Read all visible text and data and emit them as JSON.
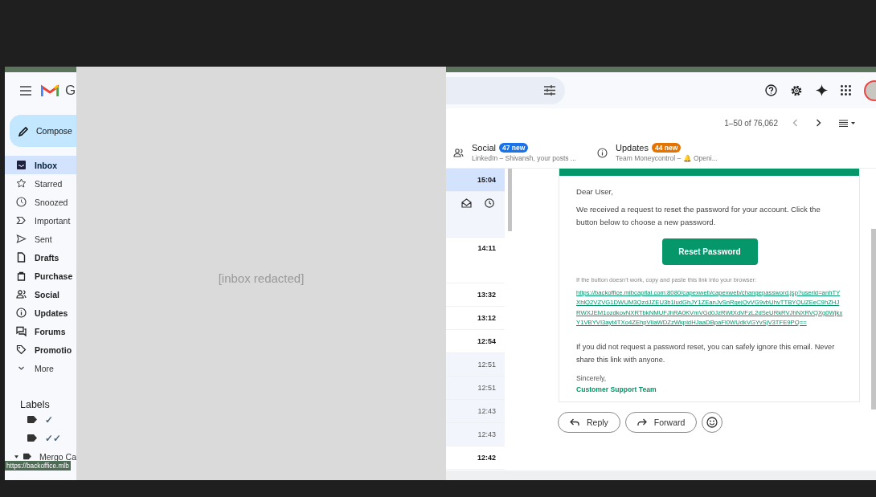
{
  "app_header": {
    "brand_letter": "G"
  },
  "compose": {
    "label": "Compose"
  },
  "sidebar": {
    "items": [
      {
        "label": "Inbox",
        "selected": true,
        "unread": true
      },
      {
        "label": "Starred",
        "selected": false,
        "unread": false
      },
      {
        "label": "Snoozed",
        "selected": false,
        "unread": false
      },
      {
        "label": "Important",
        "selected": false,
        "unread": false
      },
      {
        "label": "Sent",
        "selected": false,
        "unread": false
      },
      {
        "label": "Drafts",
        "selected": false,
        "unread": true
      },
      {
        "label": "Purchase",
        "selected": false,
        "unread": true
      },
      {
        "label": "Social",
        "selected": false,
        "unread": true
      },
      {
        "label": "Updates",
        "selected": false,
        "unread": true
      },
      {
        "label": "Forums",
        "selected": false,
        "unread": true
      },
      {
        "label": "Promotio",
        "selected": false,
        "unread": true
      },
      {
        "label": "More",
        "selected": false,
        "unread": false
      }
    ],
    "labels_heading": "Labels",
    "labels": [
      {
        "name": "✓",
        "expandable": false
      },
      {
        "name": "✓✓",
        "expandable": false
      },
      {
        "name": "Mergo Ca",
        "expandable": true
      }
    ]
  },
  "status_tooltip": "https://backoffice.mlb",
  "redaction": {
    "text": "[inbox redacted]"
  },
  "pagination": {
    "range": "1–50 of 76,062"
  },
  "category_tabs": [
    {
      "label": "Social",
      "badge": "47 new",
      "color": "#1a73e8",
      "snippet": "LinkedIn – Shivansh, your posts ..."
    },
    {
      "label": "Updates",
      "badge": "44 new",
      "color": "#e37400",
      "snippet": "Team Moneycontrol – 🔔 Openi..."
    }
  ],
  "message_rows": [
    {
      "kind": "time",
      "time": "15:04",
      "unread": true,
      "selected": true,
      "tall": false
    },
    {
      "kind": "actions",
      "unread": false,
      "selected": false,
      "tall": true
    },
    {
      "kind": "time",
      "time": "14:11",
      "unread": true,
      "selected": false,
      "tall": true
    },
    {
      "kind": "time",
      "time": "13:32",
      "unread": true,
      "selected": false,
      "tall": false
    },
    {
      "kind": "time",
      "time": "13:12",
      "unread": true,
      "selected": false,
      "tall": false
    },
    {
      "kind": "time",
      "time": "12:54",
      "unread": true,
      "selected": false,
      "tall": false
    },
    {
      "kind": "time",
      "time": "12:51",
      "unread": false,
      "selected": false,
      "tall": false
    },
    {
      "kind": "time",
      "time": "12:51",
      "unread": false,
      "selected": false,
      "tall": false
    },
    {
      "kind": "time",
      "time": "12:43",
      "unread": false,
      "selected": false,
      "tall": false
    },
    {
      "kind": "time",
      "time": "12:43",
      "unread": false,
      "selected": false,
      "tall": false
    },
    {
      "kind": "time",
      "time": "12:42",
      "unread": true,
      "selected": false,
      "tall": false
    }
  ],
  "email": {
    "greeting": "Dear User,",
    "intro": "We received a request to reset the password for your account. Click the button below to choose a new password.",
    "button": "Reset Password",
    "fallback_note": "If the button doesn't work, copy and paste this link into your browser:",
    "link": "https://backoffice.mlbcapital.com:8080/capexweb/capexweb/changepassword.jsp?userid=anhTYXhlQ2VZVG1DWUM3QzdJZEU3b1ludGhJY1ZEanJvSnRqejQvVG9vbUhvTTBYQUZEeC9hZHJRWXJEM1ozdkovNXRTbkNMUFJhRA0KVmVGd0JzRWtXdVFzL2dSeURkRVJhNXRVQXg0WjkxY1VBYVI3ayt4TXo4ZEhpVllaWDZzWkpidHJaaDBpaFl0WUdkVGYvSjV3TFE9PQ==",
    "disclaimer": "If you did not request a password reset, you can safely ignore this email. Never share this link with anyone.",
    "closing": "Sincerely,",
    "signature": "Customer Support Team"
  },
  "actions": [
    {
      "label": "Reply"
    },
    {
      "label": "Forward"
    }
  ]
}
